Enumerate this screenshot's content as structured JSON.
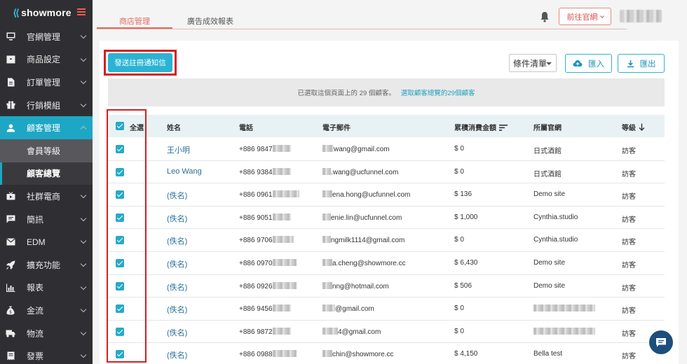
{
  "brand": {
    "name": "showmore"
  },
  "sidebar": {
    "items": [
      {
        "label": "官網管理",
        "icon": "monitor-icon",
        "chevron": "down"
      },
      {
        "label": "商品設定",
        "icon": "box-icon",
        "chevron": "down"
      },
      {
        "label": "訂單管理",
        "icon": "document-icon",
        "chevron": "down"
      },
      {
        "label": "行銷模組",
        "icon": "gift-icon",
        "chevron": "down"
      },
      {
        "label": "顧客管理",
        "icon": "user-icon",
        "chevron": "up",
        "active": true
      },
      {
        "label": "社群電商",
        "icon": "tv-icon",
        "chevron": "down"
      },
      {
        "label": "簡訊",
        "icon": "message-icon",
        "chevron": "down"
      },
      {
        "label": "EDM",
        "icon": "mail-icon",
        "chevron": "down"
      },
      {
        "label": "擴充功能",
        "icon": "rocket-icon",
        "chevron": "down"
      },
      {
        "label": "報表",
        "icon": "chart-icon",
        "chevron": "down"
      },
      {
        "label": "金流",
        "icon": "moneybag-icon",
        "chevron": "down"
      },
      {
        "label": "物流",
        "icon": "truck-icon",
        "chevron": "down"
      },
      {
        "label": "發票",
        "icon": "receipt-icon",
        "chevron": "down"
      }
    ],
    "sub_items": [
      {
        "label": "會員等級"
      },
      {
        "label": "顧客總覽"
      }
    ]
  },
  "header": {
    "tabs": [
      {
        "label": "商店管理"
      },
      {
        "label": "廣告成效報表"
      }
    ],
    "go_site_label": "前往官網"
  },
  "toolbar": {
    "send_label": "發送註冊通知信",
    "filter_label": "條件清單",
    "import_label": "匯入",
    "export_label": "匯出"
  },
  "notice": {
    "text": "已選取這個頁面上的 29 個顧客。",
    "link": "選取顧客總覽的29個顧客"
  },
  "table": {
    "headers": {
      "select_all": "全選",
      "name": "姓名",
      "phone": "電話",
      "email": "電子郵件",
      "total": "累積消費金額",
      "site": "所屬官網",
      "level": "等級"
    },
    "rows": [
      {
        "name": "王小明",
        "phone": "+886 9847",
        "email": "wang@gmail.com",
        "total": "$ 0",
        "site": "日式酒館",
        "level": "訪客"
      },
      {
        "name": "Leo Wang",
        "phone": "+886 9384",
        "email": ".wang@ucfunnel.com",
        "total": "$ 0",
        "site": "日式酒館",
        "level": "訪客"
      },
      {
        "name": "(佚名)",
        "phone": "+886 0961",
        "email": "ena.hong@ucfunnel.com",
        "total": "$ 136",
        "site": "Demo site",
        "level": "訪客"
      },
      {
        "name": "(佚名)",
        "phone": "+886 9051",
        "email": "enie.lin@ucfunnel.com",
        "total": "$ 1,000",
        "site": "Cynthia.studio",
        "level": "訪客"
      },
      {
        "name": "(佚名)",
        "phone": "+886 9706",
        "email": "ngmilk1114@gmail.com",
        "total": "$ 0",
        "site": "Cynthia.studio",
        "level": "訪客"
      },
      {
        "name": "(佚名)",
        "phone": "+886 0970",
        "email": "a.cheng@showmore.cc",
        "total": "$ 6,430",
        "site": "Demo site",
        "level": "訪客"
      },
      {
        "name": "(佚名)",
        "phone": "+886 0926",
        "email": "nng@hotmail.com",
        "total": "$ 506",
        "site": "Demo site",
        "level": "訪客"
      },
      {
        "name": "(佚名)",
        "phone": "+886 9456",
        "email": "@gmail.com",
        "total": "$ 0",
        "site": "",
        "level": "訪客"
      },
      {
        "name": "(佚名)",
        "phone": "+886 9872",
        "email": "4@gmail.com",
        "total": "$ 0",
        "site": "",
        "level": "訪客"
      },
      {
        "name": "(佚名)",
        "phone": "+886 0988",
        "email": "chin@showmore.cc",
        "total": "$ 4,150",
        "site": "Bella test",
        "level": "訪客"
      }
    ]
  }
}
